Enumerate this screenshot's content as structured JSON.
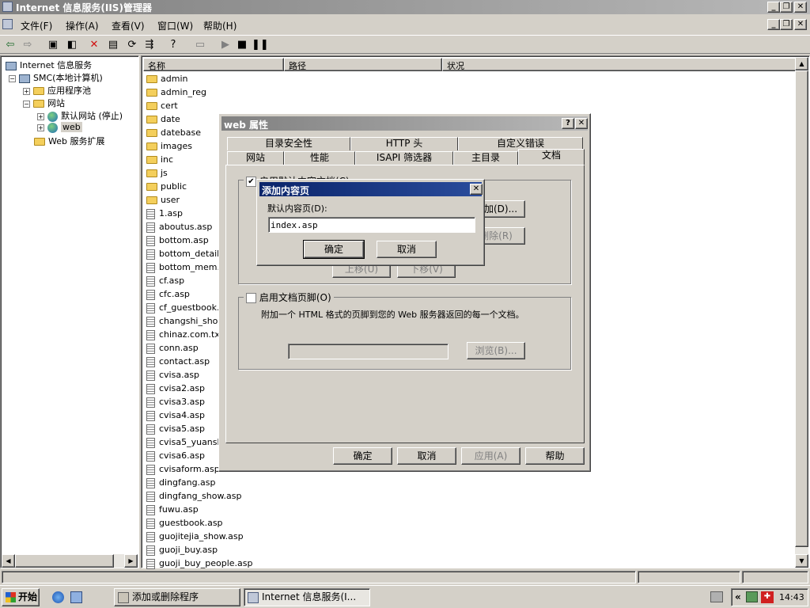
{
  "app": {
    "title": "Internet 信息服务(IIS)管理器"
  },
  "menu": [
    "文件(F)",
    "操作(A)",
    "查看(V)",
    "窗口(W)",
    "帮助(H)"
  ],
  "tree": {
    "root": "Internet 信息服务",
    "computer": "SMC(本地计算机)",
    "app_pools": "应用程序池",
    "websites": "网站",
    "default_site": "默认网站 (停止)",
    "web": "web",
    "extensions": "Web 服务扩展"
  },
  "columns": [
    "名称",
    "路径",
    "状况"
  ],
  "files": {
    "folders": [
      "admin",
      "admin_reg",
      "cert",
      "date",
      "datebase",
      "images",
      "inc",
      "js",
      "public",
      "user"
    ],
    "items": [
      "1.asp",
      "aboutus.asp",
      "bottom.asp",
      "bottom_detail",
      "bottom_mem.as",
      "cf.asp",
      "cfc.asp",
      "cf_guestbook.",
      "changshi_show",
      "chinaz.com.tx",
      "conn.asp",
      "contact.asp",
      "cvisa.asp",
      "cvisa2.asp",
      "cvisa3.asp",
      "cvisa4.asp",
      "cvisa5.asp",
      "cvisa5_yuansh",
      "cvisa6.asp",
      "cvisaform.asp",
      "dingfang.asp",
      "dingfang_show.asp",
      "fuwu.asp",
      "guestbook.asp",
      "guojitejia_show.asp",
      "guoji_buy.asp",
      "guoji_buy_people.asp"
    ]
  },
  "props": {
    "title": "web 属性",
    "help_icon": "?",
    "close_icon": "✕",
    "tabs_back": [
      "目录安全性",
      "HTTP 头",
      "自定义错误"
    ],
    "tabs_front": [
      "网站",
      "性能",
      "ISAPI 筛选器",
      "主目录",
      "文档"
    ],
    "enable_default": "启用默认内容文档(C)",
    "add_btn": "添加(D)...",
    "remove_btn": "删除(R)",
    "up_btn": "上移(U)",
    "down_btn": "下移(V)",
    "enable_footer": "启用文档页脚(O)",
    "footer_desc": "附加一个 HTML 格式的页脚到您的 Web 服务器返回的每一个文档。",
    "browse_btn": "浏览(B)...",
    "ok": "确定",
    "cancel": "取消",
    "apply": "应用(A)",
    "help": "帮助"
  },
  "add_dialog": {
    "title": "添加内容页",
    "label": "默认内容页(D):",
    "value": "index.asp",
    "ok": "确定",
    "cancel": "取消"
  },
  "taskbar": {
    "start": "开始",
    "task1": "添加或删除程序",
    "task2": "Internet 信息服务(I...",
    "clock": "14:43",
    "chevron": "«"
  }
}
